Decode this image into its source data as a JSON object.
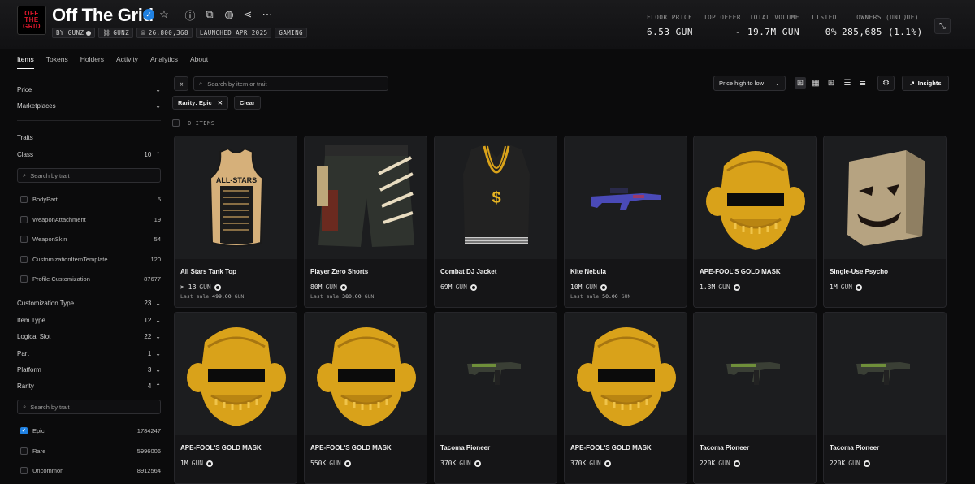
{
  "collection": {
    "logo_lines": [
      "OFF",
      "THE",
      "GRID"
    ],
    "title": "Off The Grid",
    "tags": [
      {
        "label": "BY GUNZ",
        "icon": "verified-dot-icon"
      },
      {
        "label": "GUNZ",
        "icon": "chain-icon"
      },
      {
        "label": "26,800,368",
        "icon": "supply-icon"
      },
      {
        "label": "LAUNCHED APR 2025",
        "icon": ""
      },
      {
        "label": "GAMING",
        "icon": ""
      }
    ],
    "stats": [
      {
        "label": "FLOOR PRICE",
        "value": "6.53 GUN"
      },
      {
        "label": "TOP OFFER",
        "value": "-"
      },
      {
        "label": "TOTAL VOLUME",
        "value": "19.7M GUN"
      },
      {
        "label": "LISTED",
        "value": "0%"
      },
      {
        "label": "OWNERS (UNIQUE)",
        "value": "285,685 (1.1%)"
      }
    ]
  },
  "tabs": [
    "Items",
    "Tokens",
    "Holders",
    "Activity",
    "Analytics",
    "About"
  ],
  "sidebar": {
    "price": "Price",
    "marketplaces": "Marketplaces",
    "traits": "Traits",
    "class": {
      "label": "Class",
      "count": "10"
    },
    "class_search_placeholder": "Search by trait",
    "class_options": [
      {
        "label": "BodyPart",
        "count": "5"
      },
      {
        "label": "WeaponAttachment",
        "count": "19"
      },
      {
        "label": "WeaponSkin",
        "count": "54"
      },
      {
        "label": "CustomizationItemTemplate",
        "count": "120"
      },
      {
        "label": "Profile Customization",
        "count": "87677"
      }
    ],
    "filters": [
      {
        "label": "Customization Type",
        "count": "23"
      },
      {
        "label": "Item Type",
        "count": "12"
      },
      {
        "label": "Logical Slot",
        "count": "22"
      },
      {
        "label": "Part",
        "count": "1"
      },
      {
        "label": "Platform",
        "count": "3"
      }
    ],
    "rarity": {
      "label": "Rarity",
      "count": "4"
    },
    "rarity_search_placeholder": "Search by trait",
    "rarity_options": [
      {
        "label": "Epic",
        "count": "1784247",
        "checked": true
      },
      {
        "label": "Rare",
        "count": "5996006",
        "checked": false
      },
      {
        "label": "Uncommon",
        "count": "8912564",
        "checked": false
      }
    ]
  },
  "toolbar": {
    "search_placeholder": "Search by item or trait",
    "sort": "Price high to low",
    "insights": "Insights",
    "chip": "Rarity: Epic",
    "clear": "Clear",
    "items_count": "0 ITEMS"
  },
  "cards": [
    {
      "name": "All Stars Tank Top",
      "price": "> 1B",
      "unit": "GUN",
      "last_label": "Last sale",
      "last_value": "499.00",
      "last_unit": "GUN",
      "art": "tank-top"
    },
    {
      "name": "Player Zero Shorts",
      "price": "80M",
      "unit": "GUN",
      "last_label": "Last sale",
      "last_value": "380.00",
      "last_unit": "GUN",
      "art": "shorts"
    },
    {
      "name": "Combat DJ Jacket",
      "price": "69M",
      "unit": "GUN",
      "last_label": "",
      "last_value": "",
      "last_unit": "",
      "art": "vest"
    },
    {
      "name": "Kite Nebula",
      "price": "10M",
      "unit": "GUN",
      "last_label": "Last sale",
      "last_value": "50.00",
      "last_unit": "GUN",
      "art": "rifle-blue"
    },
    {
      "name": "APE-FOOL'S GOLD MASK",
      "price": "1.3M",
      "unit": "GUN",
      "last_label": "",
      "last_value": "",
      "last_unit": "",
      "art": "gold-mask"
    },
    {
      "name": "Single-Use Psycho",
      "price": "1M",
      "unit": "GUN",
      "last_label": "",
      "last_value": "",
      "last_unit": "",
      "art": "box-mask"
    },
    {
      "name": "APE-FOOL'S GOLD MASK",
      "price": "1M",
      "unit": "GUN",
      "last_label": "",
      "last_value": "",
      "last_unit": "",
      "art": "gold-mask"
    },
    {
      "name": "APE-FOOL'S GOLD MASK",
      "price": "550K",
      "unit": "GUN",
      "last_label": "",
      "last_value": "",
      "last_unit": "",
      "art": "gold-mask"
    },
    {
      "name": "Tacoma Pioneer",
      "price": "370K",
      "unit": "GUN",
      "last_label": "",
      "last_value": "",
      "last_unit": "",
      "art": "smg-green"
    },
    {
      "name": "APE-FOOL'S GOLD MASK",
      "price": "370K",
      "unit": "GUN",
      "last_label": "",
      "last_value": "",
      "last_unit": "",
      "art": "gold-mask"
    },
    {
      "name": "Tacoma Pioneer",
      "price": "220K",
      "unit": "GUN",
      "last_label": "",
      "last_value": "",
      "last_unit": "",
      "art": "smg-green"
    },
    {
      "name": "Tacoma Pioneer",
      "price": "220K",
      "unit": "GUN",
      "last_label": "",
      "last_value": "",
      "last_unit": "",
      "art": "smg-green"
    }
  ],
  "colors": {
    "accent": "#2081e2",
    "background": "#0b0b0c",
    "card": "#151517",
    "gold": "#d9a21a"
  }
}
